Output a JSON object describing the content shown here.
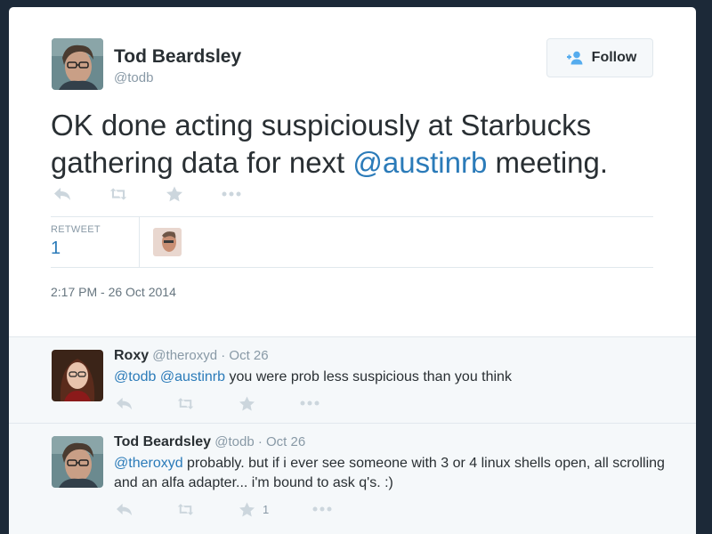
{
  "tweet": {
    "author": {
      "name": "Tod Beardsley",
      "handle": "@todb"
    },
    "follow_label": "Follow",
    "text_before": "OK done acting suspiciously at Starbucks gathering data for next ",
    "mention": "@austinrb",
    "text_after": " meeting.",
    "stats": {
      "label": "RETWEET",
      "value": "1"
    },
    "timestamp": "2:17 PM - 26 Oct 2014",
    "actions": [
      "reply-icon",
      "retweet-icon",
      "favorite-icon",
      "more-icon"
    ]
  },
  "replies": [
    {
      "name": "Roxy",
      "handle": "@theroxyd",
      "sep": " · ",
      "date": "Oct 26",
      "mentions": "@todb @austinrb",
      "text": " you were prob less suspicious than you think",
      "favorite_count": ""
    },
    {
      "name": "Tod Beardsley",
      "handle": "@todb",
      "sep": " · ",
      "date": "Oct 26",
      "mentions": "@theroxyd",
      "text": " probably. but if i ever see someone with 3 or 4 linux shells open, all scrolling and an alfa adapter... i'm bound to ask q's. :)",
      "favorite_count": "1"
    }
  ],
  "colors": {
    "background": "#1c2938",
    "link": "#2b7bb9",
    "text": "#292f33",
    "muted": "#8899a6",
    "icon": "#ccd6dd"
  }
}
